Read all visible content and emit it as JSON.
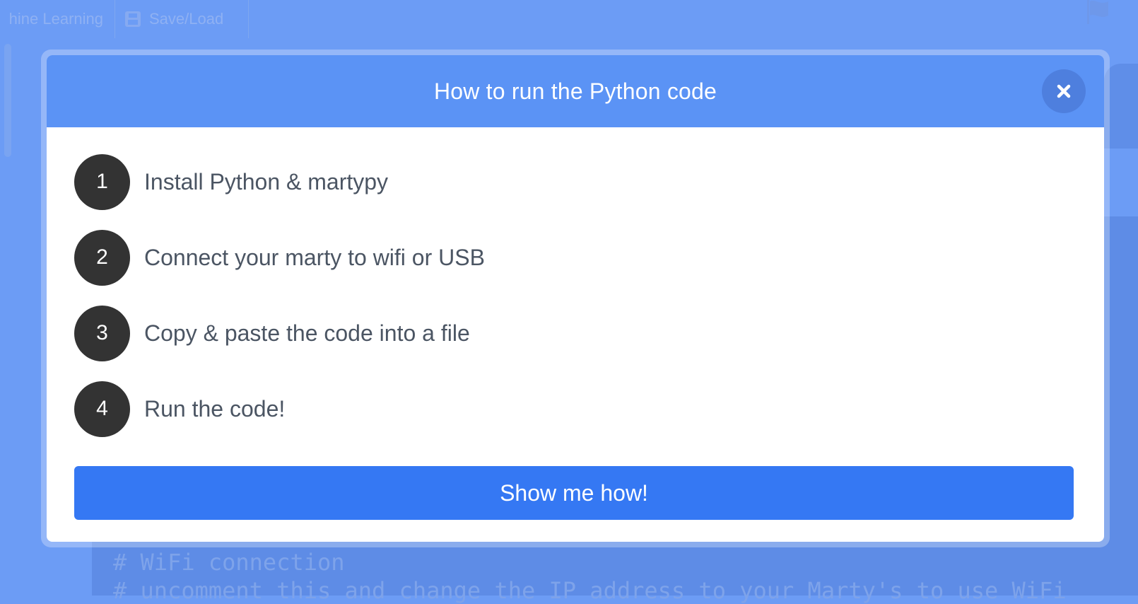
{
  "background": {
    "tabs": [
      {
        "label": "hine Learning"
      },
      {
        "label": "Save/Load",
        "icon": "save-icon"
      }
    ],
    "flag_icon": "flag-icon",
    "code_lines": [
      "# WiFi connection",
      "# uncomment this and change the IP address to your Marty's to use WiFi"
    ]
  },
  "modal": {
    "title": "How to run the Python code",
    "close_icon": "close-icon",
    "steps": [
      {
        "number": "1",
        "label": "Install Python & martypy"
      },
      {
        "number": "2",
        "label": "Connect your marty to wifi or USB"
      },
      {
        "number": "3",
        "label": "Copy & paste the code into a file"
      },
      {
        "number": "4",
        "label": "Run the code!"
      }
    ],
    "action_label": "Show me how!"
  },
  "colors": {
    "header": "#5b93f5",
    "primary": "#3578f3",
    "badge": "#333333",
    "backdrop": "#6c9cf5"
  }
}
